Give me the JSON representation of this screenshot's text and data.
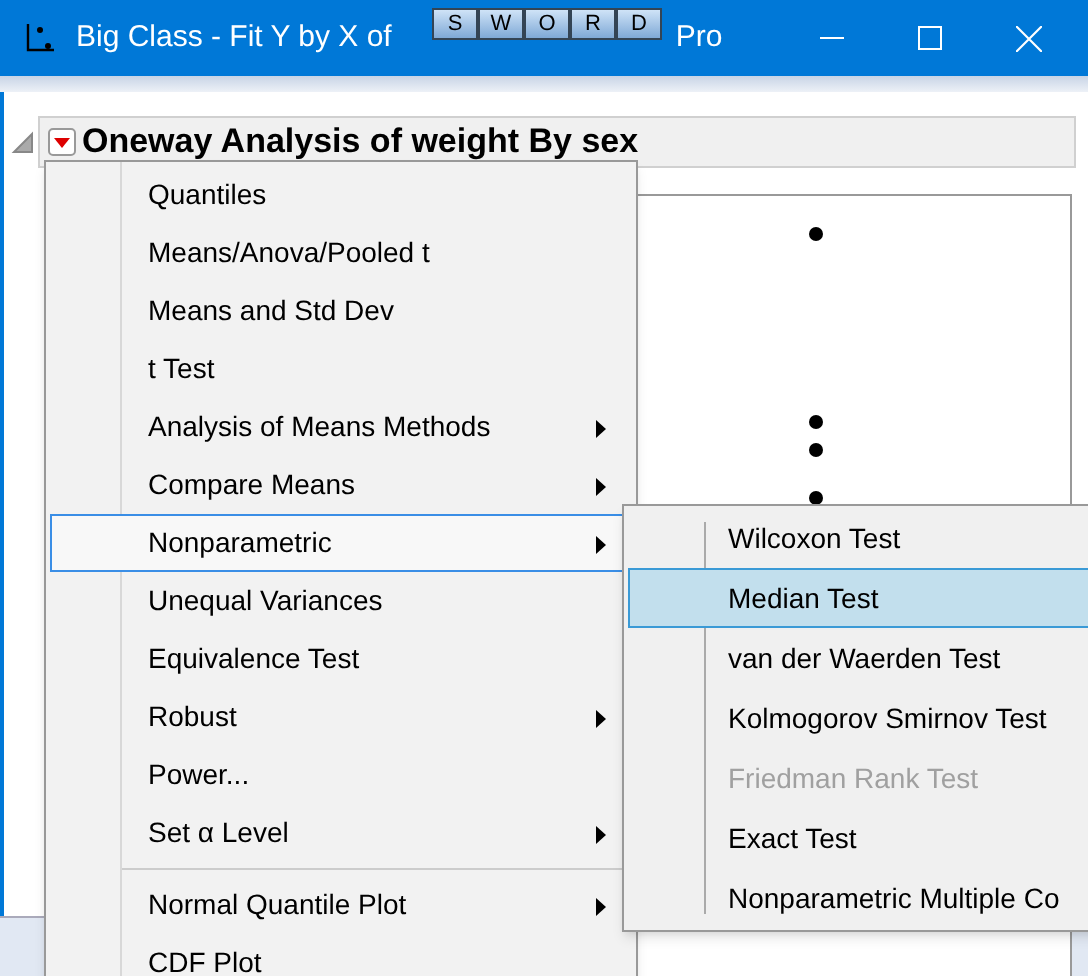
{
  "window": {
    "title_parts": [
      "Big Class - Fit Y by X of",
      "Pro"
    ],
    "overlay_toolbar": [
      "S",
      "W",
      "O",
      "R",
      "D"
    ]
  },
  "report": {
    "title": "Oneway Analysis of weight By sex",
    "expanded": true
  },
  "menu": [
    {
      "kind": "item",
      "label": "Quantiles",
      "submenu": false,
      "selected": false
    },
    {
      "kind": "item",
      "label": "Means/Anova/Pooled t",
      "submenu": false,
      "selected": false
    },
    {
      "kind": "item",
      "label": "Means and Std Dev",
      "submenu": false,
      "selected": false
    },
    {
      "kind": "item",
      "label": "t Test",
      "submenu": false,
      "selected": false
    },
    {
      "kind": "item",
      "label": "Analysis of Means Methods",
      "submenu": true,
      "selected": false
    },
    {
      "kind": "item",
      "label": "Compare Means",
      "submenu": true,
      "selected": false
    },
    {
      "kind": "item",
      "label": "Nonparametric",
      "submenu": true,
      "selected": true
    },
    {
      "kind": "item",
      "label": "Unequal Variances",
      "submenu": false,
      "selected": false
    },
    {
      "kind": "item",
      "label": "Equivalence Test",
      "submenu": false,
      "selected": false
    },
    {
      "kind": "item",
      "label": "Robust",
      "submenu": true,
      "selected": false
    },
    {
      "kind": "item",
      "label": "Power...",
      "submenu": false,
      "selected": false
    },
    {
      "kind": "item",
      "label": "Set α Level",
      "submenu": true,
      "selected": false
    },
    {
      "kind": "separator"
    },
    {
      "kind": "item",
      "label": "Normal Quantile Plot",
      "submenu": true,
      "selected": false
    },
    {
      "kind": "item",
      "label": "CDF Plot",
      "submenu": false,
      "selected": false
    }
  ],
  "submenu": [
    {
      "label": "Wilcoxon Test",
      "selected": false,
      "disabled": false
    },
    {
      "label": "Median Test",
      "selected": true,
      "disabled": false
    },
    {
      "label": "van der Waerden Test",
      "selected": false,
      "disabled": false
    },
    {
      "label": "Kolmogorov Smirnov Test",
      "selected": false,
      "disabled": false
    },
    {
      "label": "Friedman Rank Test",
      "selected": false,
      "disabled": true
    },
    {
      "label": "Exact Test",
      "selected": false,
      "disabled": false
    },
    {
      "label": "Nonparametric Multiple Co",
      "selected": false,
      "disabled": false
    }
  ]
}
